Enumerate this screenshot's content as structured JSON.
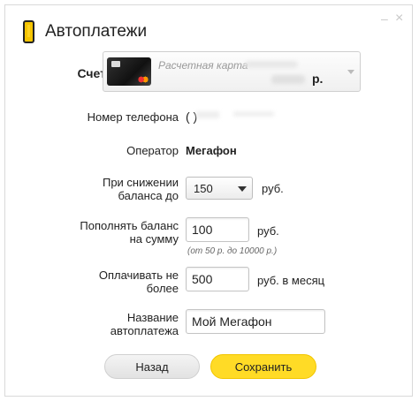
{
  "window": {
    "title": "Автоплатежи",
    "minimize_glyph": "–",
    "close_glyph": "×"
  },
  "form": {
    "account_label": "Счет",
    "card": {
      "name": "Расчетная карта",
      "amount_suffix": "р."
    },
    "phone_label": "Номер телефона",
    "phone_value": "(        )",
    "operator_label": "Оператор",
    "operator_value": "Мегафон",
    "threshold_label_1": "При снижении",
    "threshold_label_2": "баланса до",
    "threshold_value": "150",
    "threshold_unit": "руб.",
    "topup_label_1": "Пополнять баланс",
    "topup_label_2": "на сумму",
    "topup_value": "100",
    "topup_unit": "руб.",
    "topup_hint": "(от 50 р. до 10000 р.)",
    "limit_label_1": "Оплачивать не",
    "limit_label_2": "более",
    "limit_value": "500",
    "limit_unit": "руб. в месяц",
    "name_label_1": "Название",
    "name_label_2": "автоплатежа",
    "name_value": "Мой Мегафон"
  },
  "buttons": {
    "back_label": "Назад",
    "save_label": "Сохранить"
  },
  "colors": {
    "accent_yellow": "#ffdb26",
    "border": "#d9d9d9"
  },
  "icons": {
    "title_icon": "mobile-phone-icon",
    "select_arrow": "chevron-down-icon"
  }
}
